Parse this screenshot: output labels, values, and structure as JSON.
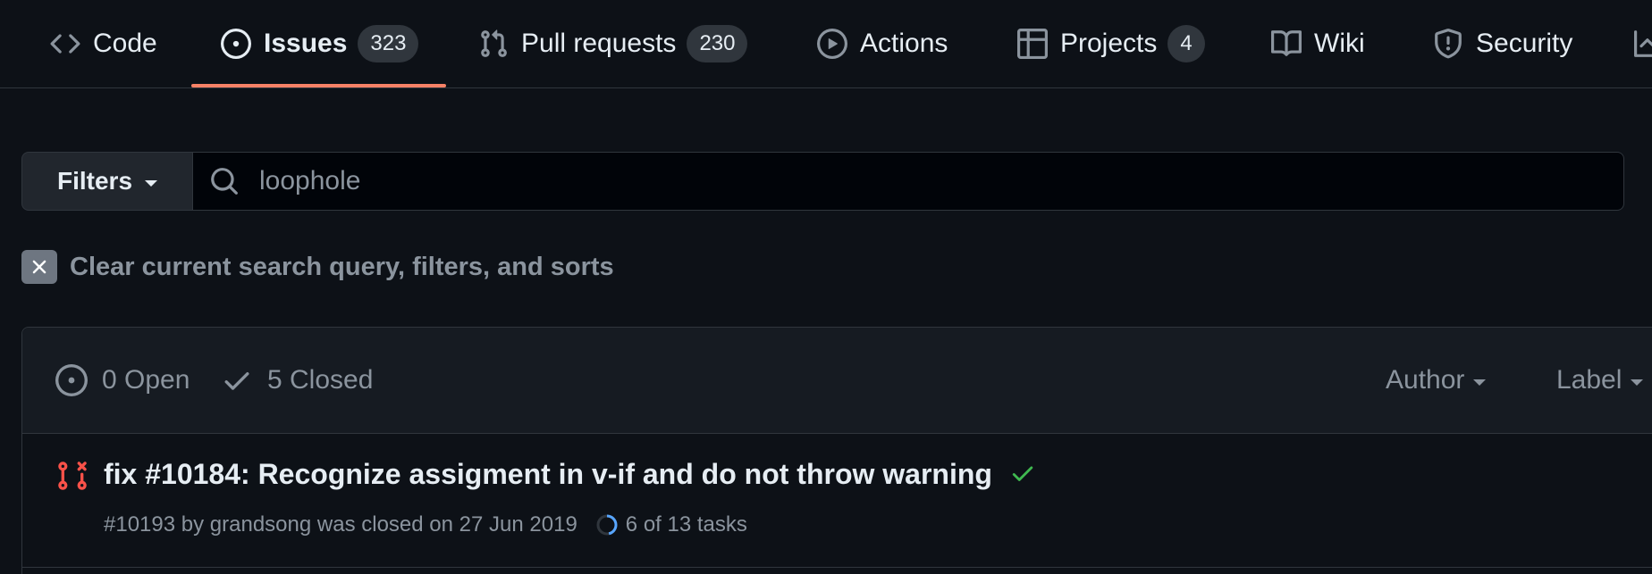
{
  "nav": {
    "tabs": [
      {
        "label": "Code",
        "icon": "code-icon"
      },
      {
        "label": "Issues",
        "icon": "issue-opened-icon",
        "counter": "323",
        "selected": true
      },
      {
        "label": "Pull requests",
        "icon": "git-pull-request-icon",
        "counter": "230"
      },
      {
        "label": "Actions",
        "icon": "play-icon"
      },
      {
        "label": "Projects",
        "icon": "table-icon",
        "counter": "4"
      },
      {
        "label": "Wiki",
        "icon": "book-icon"
      },
      {
        "label": "Security",
        "icon": "shield-icon"
      }
    ],
    "selected_underline_color": "#f78166"
  },
  "search": {
    "filters_label": "Filters",
    "query": "loophole"
  },
  "clear": {
    "label": "Clear current search query, filters, and sorts"
  },
  "list": {
    "open_label": "0 Open",
    "closed_label": "5 Closed",
    "author_label": "Author",
    "label_label": "Label",
    "issues": [
      {
        "title": "fix #10184: Recognize assigment in v-if and do not throw warning",
        "number": "#10193",
        "meta_by": "by",
        "author": "grandsong",
        "meta_closed": "was closed on",
        "date": "27 Jun 2019",
        "tasks": "6 of 13 tasks",
        "tasks_progress": 0.4615,
        "status": "success",
        "state_color": "#f85149",
        "check_color": "#3fb950"
      }
    ]
  },
  "colors": {
    "background": "#0d1117",
    "header_background": "#161b22",
    "border": "#30363d",
    "muted_text": "#8b949e",
    "text": "#e6edf3"
  }
}
